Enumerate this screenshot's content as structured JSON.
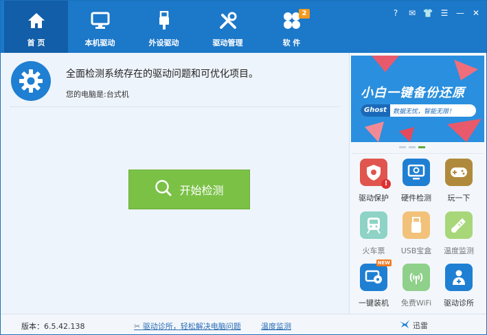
{
  "nav": {
    "tabs": [
      {
        "label": "首 页",
        "icon": "home-icon"
      },
      {
        "label": "本机驱动",
        "icon": "monitor-icon"
      },
      {
        "label": "外设驱动",
        "icon": "usb-plug-icon"
      },
      {
        "label": "驱动管理",
        "icon": "tools-icon"
      },
      {
        "label": "软 件",
        "icon": "apps-icon"
      }
    ],
    "software_badge": "2"
  },
  "window_controls": {
    "help": "?",
    "feedback": "✉",
    "skin": "👕",
    "menu": "☰",
    "minimize": "—",
    "close": "✕"
  },
  "main": {
    "headline": "全面检测系统存在的驱动问题和可优化项目。",
    "subline": "您的电脑是:台式机",
    "start_button": "开始检测"
  },
  "banner": {
    "title": "小白一键备份还原",
    "ghost": "Ghost",
    "slogan": "数据无忧，智能无限！"
  },
  "apps": [
    {
      "label": "驱动保护",
      "icon": "shield-alert-icon",
      "color": "#e0554e"
    },
    {
      "label": "硬件检测",
      "icon": "monitor-search-icon",
      "color": "#1f7fd2"
    },
    {
      "label": "玩一下",
      "icon": "gamepad-icon",
      "color": "#b08a3c"
    },
    {
      "label": "火车票",
      "icon": "train-icon",
      "color": "#8ed3c5"
    },
    {
      "label": "USB宝盒",
      "icon": "usb-box-icon",
      "color": "#f2c27a"
    },
    {
      "label": "温度监测",
      "icon": "thermometer-icon",
      "color": "#a8d77a"
    },
    {
      "label": "一键装机",
      "icon": "disk-install-icon",
      "color": "#1f7fd2",
      "badge": "NEW"
    },
    {
      "label": "免费WiFi",
      "icon": "wifi-icon",
      "color": "#8fd08a"
    },
    {
      "label": "驱动诊所",
      "icon": "doctor-icon",
      "color": "#1f7fd2"
    }
  ],
  "status": {
    "version": "版本：6.5.42.138",
    "link1": "驱动诊所，轻松解决电脑问题",
    "link2": "温度监测",
    "xunlei": "迅雷"
  },
  "colors": {
    "topbar": "#1c78c9",
    "active_tab": "#125ea8",
    "start_button": "#7bc146",
    "badge": "#f39a1e"
  }
}
